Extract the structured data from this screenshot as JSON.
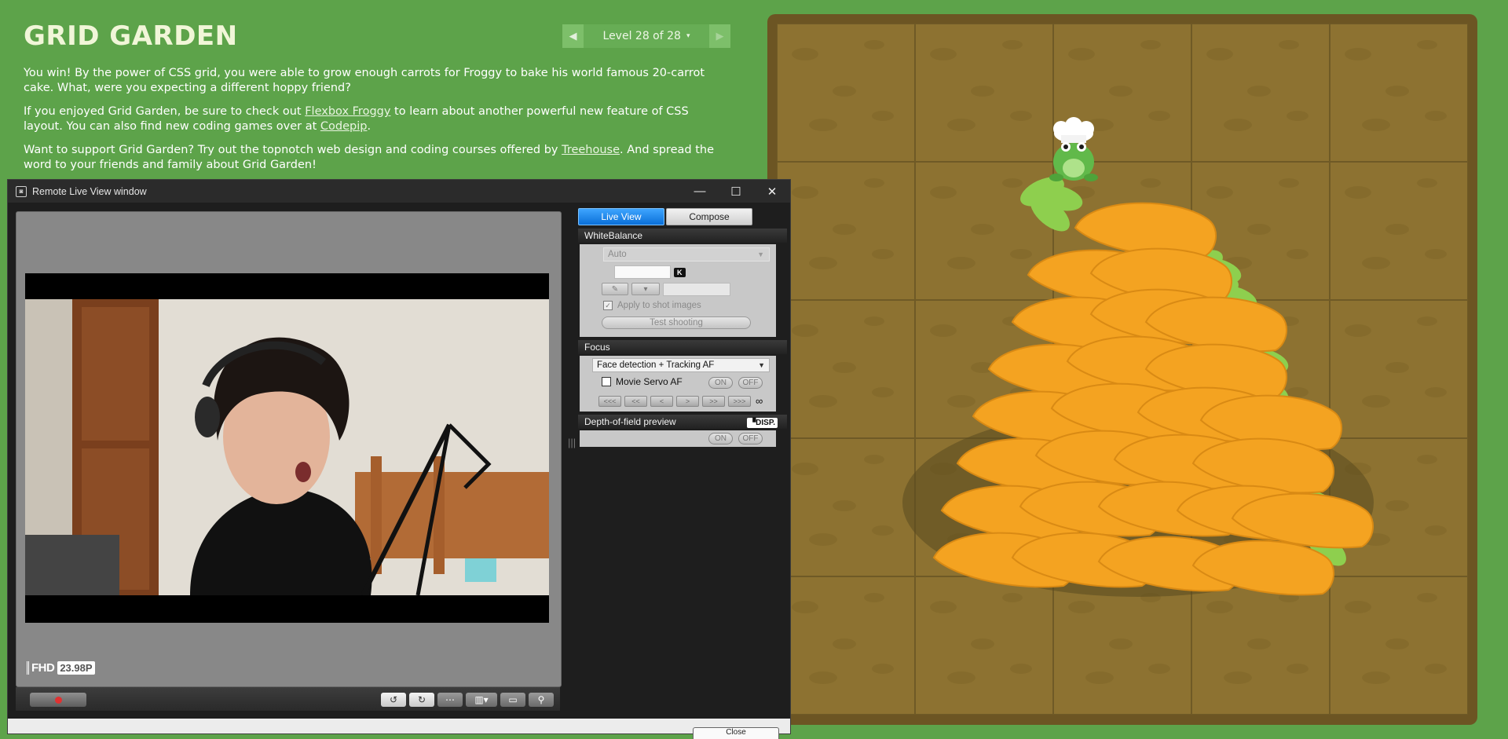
{
  "page": {
    "title": "GRID GARDEN",
    "level": {
      "prev_icon": "triangle-left",
      "next_icon": "triangle-right",
      "label": "Level 28 of 28",
      "caret": "▾"
    },
    "instructions": {
      "p1": "You win! By the power of CSS grid, you were able to grow enough carrots for Froggy to bake his world famous 20-carrot cake. What, were you expecting a different hoppy friend?",
      "p2_before": "If you enjoyed Grid Garden, be sure to check out ",
      "p2_link1": "Flexbox Froggy",
      "p2_middle": " to learn about another powerful new feature of CSS layout. You can also find new coding games over at ",
      "p2_link2": "Codepip",
      "p2_after": ".",
      "p3_before": "Want to support Grid Garden? Try out the topnotch web design and coding courses offered by ",
      "p3_link": "Treehouse",
      "p3_after": ". And spread the word to your friends and family about Grid Garden!"
    }
  },
  "live_view_window": {
    "title": "Remote Live View window",
    "window_controls": {
      "minimize": "—",
      "maximize": "☐",
      "close": "✕"
    },
    "badges": {
      "format": "FHD",
      "fps": "23.98P"
    },
    "tabs": {
      "live_view": "Live View",
      "compose": "Compose"
    },
    "white_balance": {
      "heading": "WhiteBalance",
      "mode": "Auto",
      "kelvin_badge": "K",
      "apply_label": "Apply to shot images",
      "test_shooting": "Test shooting"
    },
    "focus": {
      "heading": "Focus",
      "mode": "Face detection + Tracking AF",
      "movie_servo": "Movie Servo AF",
      "on": "ON",
      "off": "OFF",
      "steps": [
        "<<<",
        "<<",
        "<",
        ">",
        ">>",
        ">>>"
      ],
      "infinity": "∞"
    },
    "dof": {
      "heading": "Depth-of-field preview",
      "on": "ON",
      "off": "OFF"
    },
    "disp_badge": "DISP.",
    "bottom_button": "Close"
  },
  "colors": {
    "page_bg": "#5da34a",
    "garden_border": "#6c5523",
    "soil": "#8d7231",
    "carrot": "#f4a321",
    "carrot_top": "#8ecf4e",
    "live_view_tab": "#0a6fd8"
  }
}
